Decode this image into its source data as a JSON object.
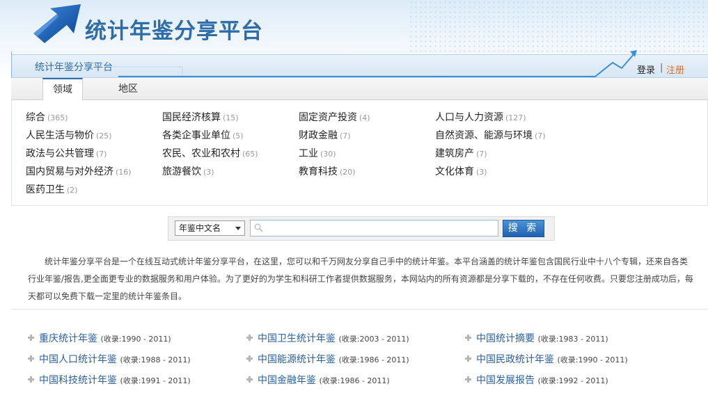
{
  "header": {
    "site_title": "统计年鉴分享平台",
    "breadcrumb": "统计年鉴分享平台",
    "login_label": "登录",
    "separator": "|",
    "register_label": "注册"
  },
  "tabs": [
    {
      "label": "领域",
      "active": true
    },
    {
      "label": "地区",
      "active": false
    }
  ],
  "categories": [
    {
      "name": "综合",
      "count": "(365)"
    },
    {
      "name": "国民经济核算",
      "count": "(15)"
    },
    {
      "name": "固定资产投资",
      "count": "(4)"
    },
    {
      "name": "人口与人力资源",
      "count": "(127)"
    },
    {
      "name": "人民生活与物价",
      "count": "(25)"
    },
    {
      "name": "各类企事业单位",
      "count": "(5)"
    },
    {
      "name": "财政金融",
      "count": "(7)"
    },
    {
      "name": "自然资源、能源与环境",
      "count": "(7)"
    },
    {
      "name": "政法与公共管理",
      "count": "(7)"
    },
    {
      "name": "农民、农业和农村",
      "count": "(65)"
    },
    {
      "name": "工业",
      "count": "(30)"
    },
    {
      "name": "建筑房产",
      "count": "(7)"
    },
    {
      "name": "国内贸易与对外经济",
      "count": "(16)"
    },
    {
      "name": "旅游餐饮",
      "count": "(3)"
    },
    {
      "name": "教育科技",
      "count": "(20)"
    },
    {
      "name": "文化体育",
      "count": "(3)"
    },
    {
      "name": "医药卫生",
      "count": "(2)"
    }
  ],
  "search": {
    "select_value": "年鉴中文名",
    "input_value": "",
    "button_label": "搜 索"
  },
  "intro": "统计年鉴分享平台是一个在线互动式统计年鉴分享平台，在这里，您可以和千万网友分享自己手中的统计年鉴。本平台涵盖的统计年鉴包含国民行业中十八个专辑，还来自各类行业年鉴/报告,更全面更专业的数据服务和用户体验。为了更好的为学生和科研工作者提供数据服务，本网站内的所有资源都是分享下载的，不存在任何收费。只要您注册成功后，每天都可以免费下载一定里的统计年鉴条目。",
  "yearbooks": [
    {
      "name": "重庆统计年鉴",
      "range": "(收录:1990 - 2011)"
    },
    {
      "name": "中国卫生统计年鉴",
      "range": "(收录:2003 - 2011)"
    },
    {
      "name": "中国统计摘要",
      "range": "(收录:1983 - 2011)"
    },
    {
      "name": "中国人口统计年鉴",
      "range": "(收录:1988 - 2011)"
    },
    {
      "name": "中国能源统计年鉴",
      "range": "(收录:1986 - 2011)"
    },
    {
      "name": "中国民政统计年鉴",
      "range": "(收录:1990 - 2011)"
    },
    {
      "name": "中国科技统计年鉴",
      "range": "(收录:1991 - 2011)"
    },
    {
      "name": "中国金融年鉴",
      "range": "(收录:1986 - 2011)"
    },
    {
      "name": "中国发展报告",
      "range": "(收录:1992 - 2011)"
    }
  ],
  "colors": {
    "brand_blue": "#2e6da8",
    "link_blue": "#2a5f9e",
    "register_orange": "#e46c1b",
    "button_blue": "#1c62b3"
  },
  "icons": {
    "logo": "arrow-logo-icon",
    "search": "search-icon",
    "bullet": "bullet-icon",
    "dropdown": "chevron-down-icon"
  }
}
